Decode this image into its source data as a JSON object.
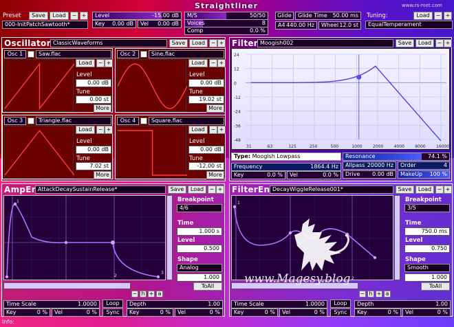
{
  "app": {
    "title": "Straightliner",
    "url": "www.rs-met.com",
    "info_label": "Info:"
  },
  "preset": {
    "label": "Preset",
    "save": "Save",
    "load": "Load",
    "minus": "−",
    "plus": "+",
    "name": "000-InitPatchSawtooth*"
  },
  "global": {
    "level_label": "Level",
    "level_value": "-15.00 dB",
    "level_fraction": 0.78,
    "key_label": "Key",
    "key_value": "0.00 dB",
    "vel_label": "Vel",
    "vel_value": "0.00 dB",
    "m5_label": "M/S",
    "m5_value": "50/50",
    "voices_label": "Voices",
    "voices_value": "8",
    "voices_fraction": 0.22,
    "comp_label": "Comp",
    "comp_value": "0.0 %",
    "glide_label": "Glide",
    "glide_time_label": "Glide Time",
    "glide_time_value": "50.00 ms",
    "a4_label": "A4",
    "a4_value": "440.00 Hz",
    "wheel_label": "Wheel",
    "wheel_value": "12.0 st",
    "tuning_label": "Tuning:",
    "tuning_load": "Load",
    "tuning_name": "EqualTemperament"
  },
  "oscillators": {
    "title": "Oscillators",
    "bank": "ClassicWaveforms",
    "save": "Save",
    "load": "Load",
    "items": [
      {
        "label": "Osc 1",
        "file": "Saw.flac",
        "load": "Load",
        "level_label": "Level",
        "level_value": "0.00 dB",
        "tune_label": "Tune",
        "tune_value": "0.00 st",
        "more": "More"
      },
      {
        "label": "Osc 2",
        "file": "Sine.flac",
        "load": "Load",
        "level_label": "Level",
        "level_value": "0.00 dB",
        "tune_label": "Tune",
        "tune_value": "19.02 st",
        "more": "More"
      },
      {
        "label": "Osc 3",
        "file": "Triangle.flac",
        "load": "Load",
        "level_label": "Level",
        "level_value": "0.00 dB",
        "tune_label": "Tune",
        "tune_value": "7.02 st",
        "more": "More"
      },
      {
        "label": "Osc 4",
        "file": "Square.flac",
        "load": "Load",
        "level_label": "Level",
        "level_value": "0.00 dB",
        "tune_label": "Tune",
        "tune_value": "-12.00 st",
        "more": "More"
      }
    ]
  },
  "filter": {
    "title": "Filter",
    "preset": "Moogish002",
    "save": "Save",
    "load": "Load",
    "y_ticks": [
      "24",
      "12",
      "0",
      "-12",
      "-24",
      "-36",
      "-48"
    ],
    "x_ticks": [
      "31",
      "63",
      "125",
      "250",
      "500",
      "1000",
      "2000",
      "4000",
      "8000",
      "16000"
    ],
    "type_label": "Type:",
    "type_value": "Moogish Lowpass",
    "resonance_label": "Resonance",
    "resonance_value": "74.1 %",
    "resonance_fraction": 0.74,
    "frequency_label": "Frequency",
    "frequency_value": "1864.4 Hz",
    "allpass_label": "Allpass",
    "allpass_value": "20000 Hz",
    "order_label": "Order",
    "order_value": "4",
    "key_label": "Key",
    "key_value": "0.0 %",
    "vel_label": "Vel",
    "vel_value": "0.0 %",
    "drive_label": "Drive",
    "drive_value": "0.00 dB",
    "makeup_label": "MakeUp",
    "makeup_value": "100 %"
  },
  "ampenv": {
    "title": "AmpEnv",
    "preset": "AttackDecaySustainRelease*",
    "save": "Save",
    "load": "Load",
    "breakpoint_label": "Breakpoint",
    "breakpoint_value": "4/6",
    "time_label": "Time",
    "time_value": "1.000 s",
    "level_label": "Level",
    "level_value": "0.500",
    "shape_label": "Shape",
    "shape_value": "Analog",
    "shape_amount": "1.000",
    "toall": "ToAll",
    "nav": [
      "−",
      "h",
      "+",
      "a"
    ],
    "point_labels": [
      "1",
      "2",
      "3"
    ],
    "timescale_label": "Time Scale",
    "timescale_value": "1.0000",
    "loop": "Loop",
    "sync": "Sync",
    "depth_label": "Depth",
    "depth_value": "1.00",
    "key_label": "Key",
    "key_value": "0 %",
    "vel_label": "Vel",
    "vel_value": "0 %",
    "key2_label": "Key",
    "key2_value": "0 %",
    "vel2_label": "Vel",
    "vel2_value": "0 %"
  },
  "filterenv": {
    "title": "FilterEnv",
    "preset": "DecayWiggleRelease001*",
    "save": "Save",
    "load": "Load",
    "breakpoint_label": "Breakpoint",
    "breakpoint_value": "3/5",
    "time_label": "Time",
    "time_value": "750.0 ms",
    "level_label": "Level",
    "level_value": "0.750",
    "shape_label": "Shape",
    "shape_value": "Smooth",
    "shape_amount": "1.000",
    "toall": "ToAll",
    "nav": [
      "−",
      "h",
      "+",
      "a"
    ],
    "point_labels": [
      "1",
      "2"
    ],
    "timescale_label": "Time Scale",
    "timescale_value": "1.0000",
    "loop": "Loop",
    "sync": "Sync",
    "depth_label": "Depth",
    "depth_value": "1.00",
    "key_label": "Key",
    "key_value": "0 %",
    "vel_label": "Vel",
    "vel_value": "0 %",
    "key2_label": "Key",
    "key2_value": "0 %",
    "vel2_label": "Vel",
    "vel2_value": "0 %"
  },
  "watermark": "www.Magesy.blog",
  "colors": {
    "osc_bg": "#6a0000",
    "osc_wave": "#ff4040",
    "env_bg": "#24003a",
    "env_curve": "#b070ff",
    "filter_curve": "#5040e0"
  }
}
